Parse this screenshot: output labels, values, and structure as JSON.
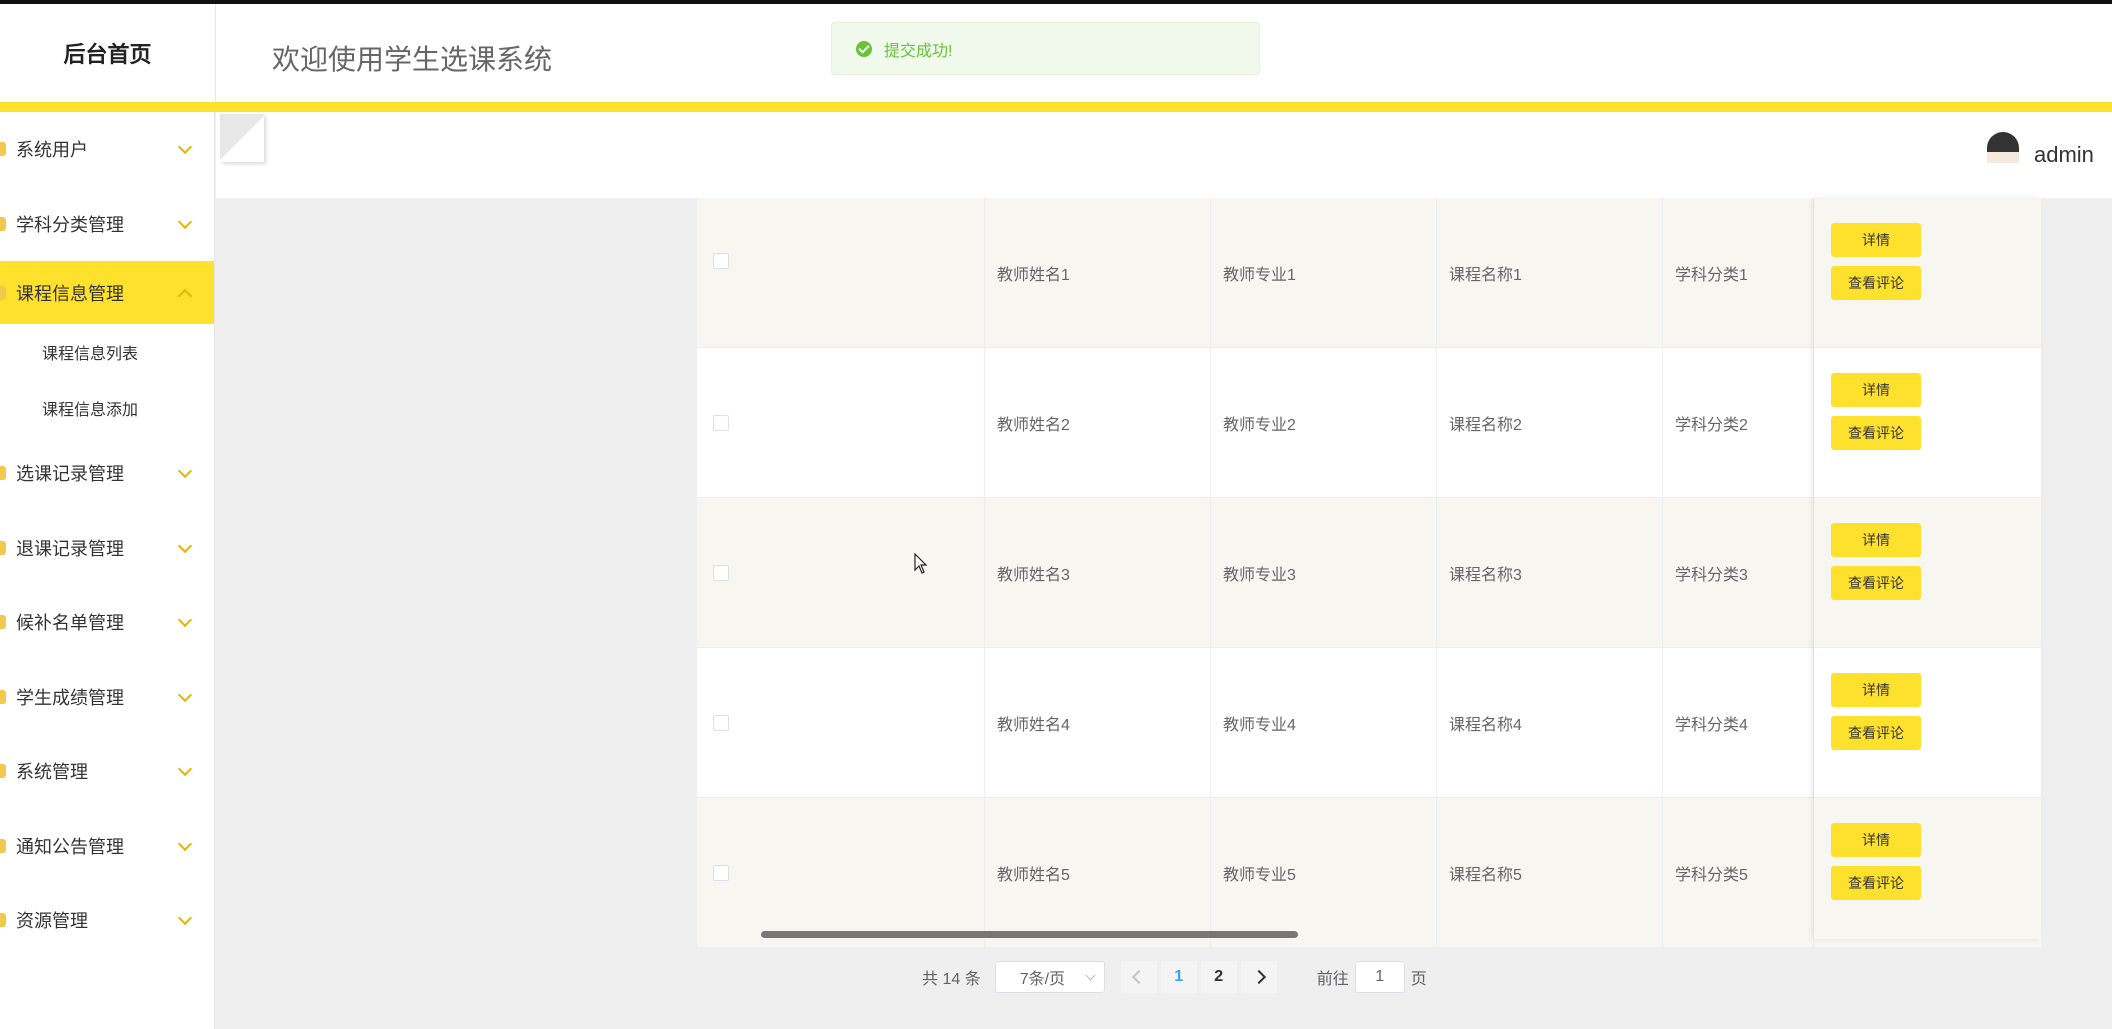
{
  "header": {
    "brand": "后台首页",
    "welcome": "欢迎使用学生选课系统",
    "toast": "提交成功!",
    "username": "admin"
  },
  "sidebar": {
    "items": [
      {
        "label": "系统用户"
      },
      {
        "label": "学科分类管理"
      },
      {
        "label": "课程信息管理",
        "active": true
      },
      {
        "label": "选课记录管理"
      },
      {
        "label": "退课记录管理"
      },
      {
        "label": "候补名单管理"
      },
      {
        "label": "学生成绩管理"
      },
      {
        "label": "系统管理"
      },
      {
        "label": "通知公告管理"
      },
      {
        "label": "资源管理"
      }
    ],
    "submenu": [
      "课程信息列表",
      "课程信息添加"
    ]
  },
  "table": {
    "rows": [
      {
        "teacher_name": "教师姓名1",
        "teacher_major": "教师专业1",
        "course_name": "课程名称1",
        "subject": "学科分类1"
      },
      {
        "teacher_name": "教师姓名2",
        "teacher_major": "教师专业2",
        "course_name": "课程名称2",
        "subject": "学科分类2"
      },
      {
        "teacher_name": "教师姓名3",
        "teacher_major": "教师专业3",
        "course_name": "课程名称3",
        "subject": "学科分类3"
      },
      {
        "teacher_name": "教师姓名4",
        "teacher_major": "教师专业4",
        "course_name": "课程名称4",
        "subject": "学科分类4"
      },
      {
        "teacher_name": "教师姓名5",
        "teacher_major": "教师专业5",
        "course_name": "课程名称5",
        "subject": "学科分类5"
      }
    ],
    "detail_label": "详情",
    "comment_label": "查看评论"
  },
  "pagination": {
    "total": "共 14 条",
    "page_size": "7条/页",
    "pages": [
      "1",
      "2"
    ],
    "current": "1",
    "goto_prefix": "前往",
    "goto_value": "1",
    "goto_suffix": "页"
  },
  "colors": {
    "accent": "#fee12d",
    "success": "#67c23a",
    "active_page": "#409eff"
  }
}
